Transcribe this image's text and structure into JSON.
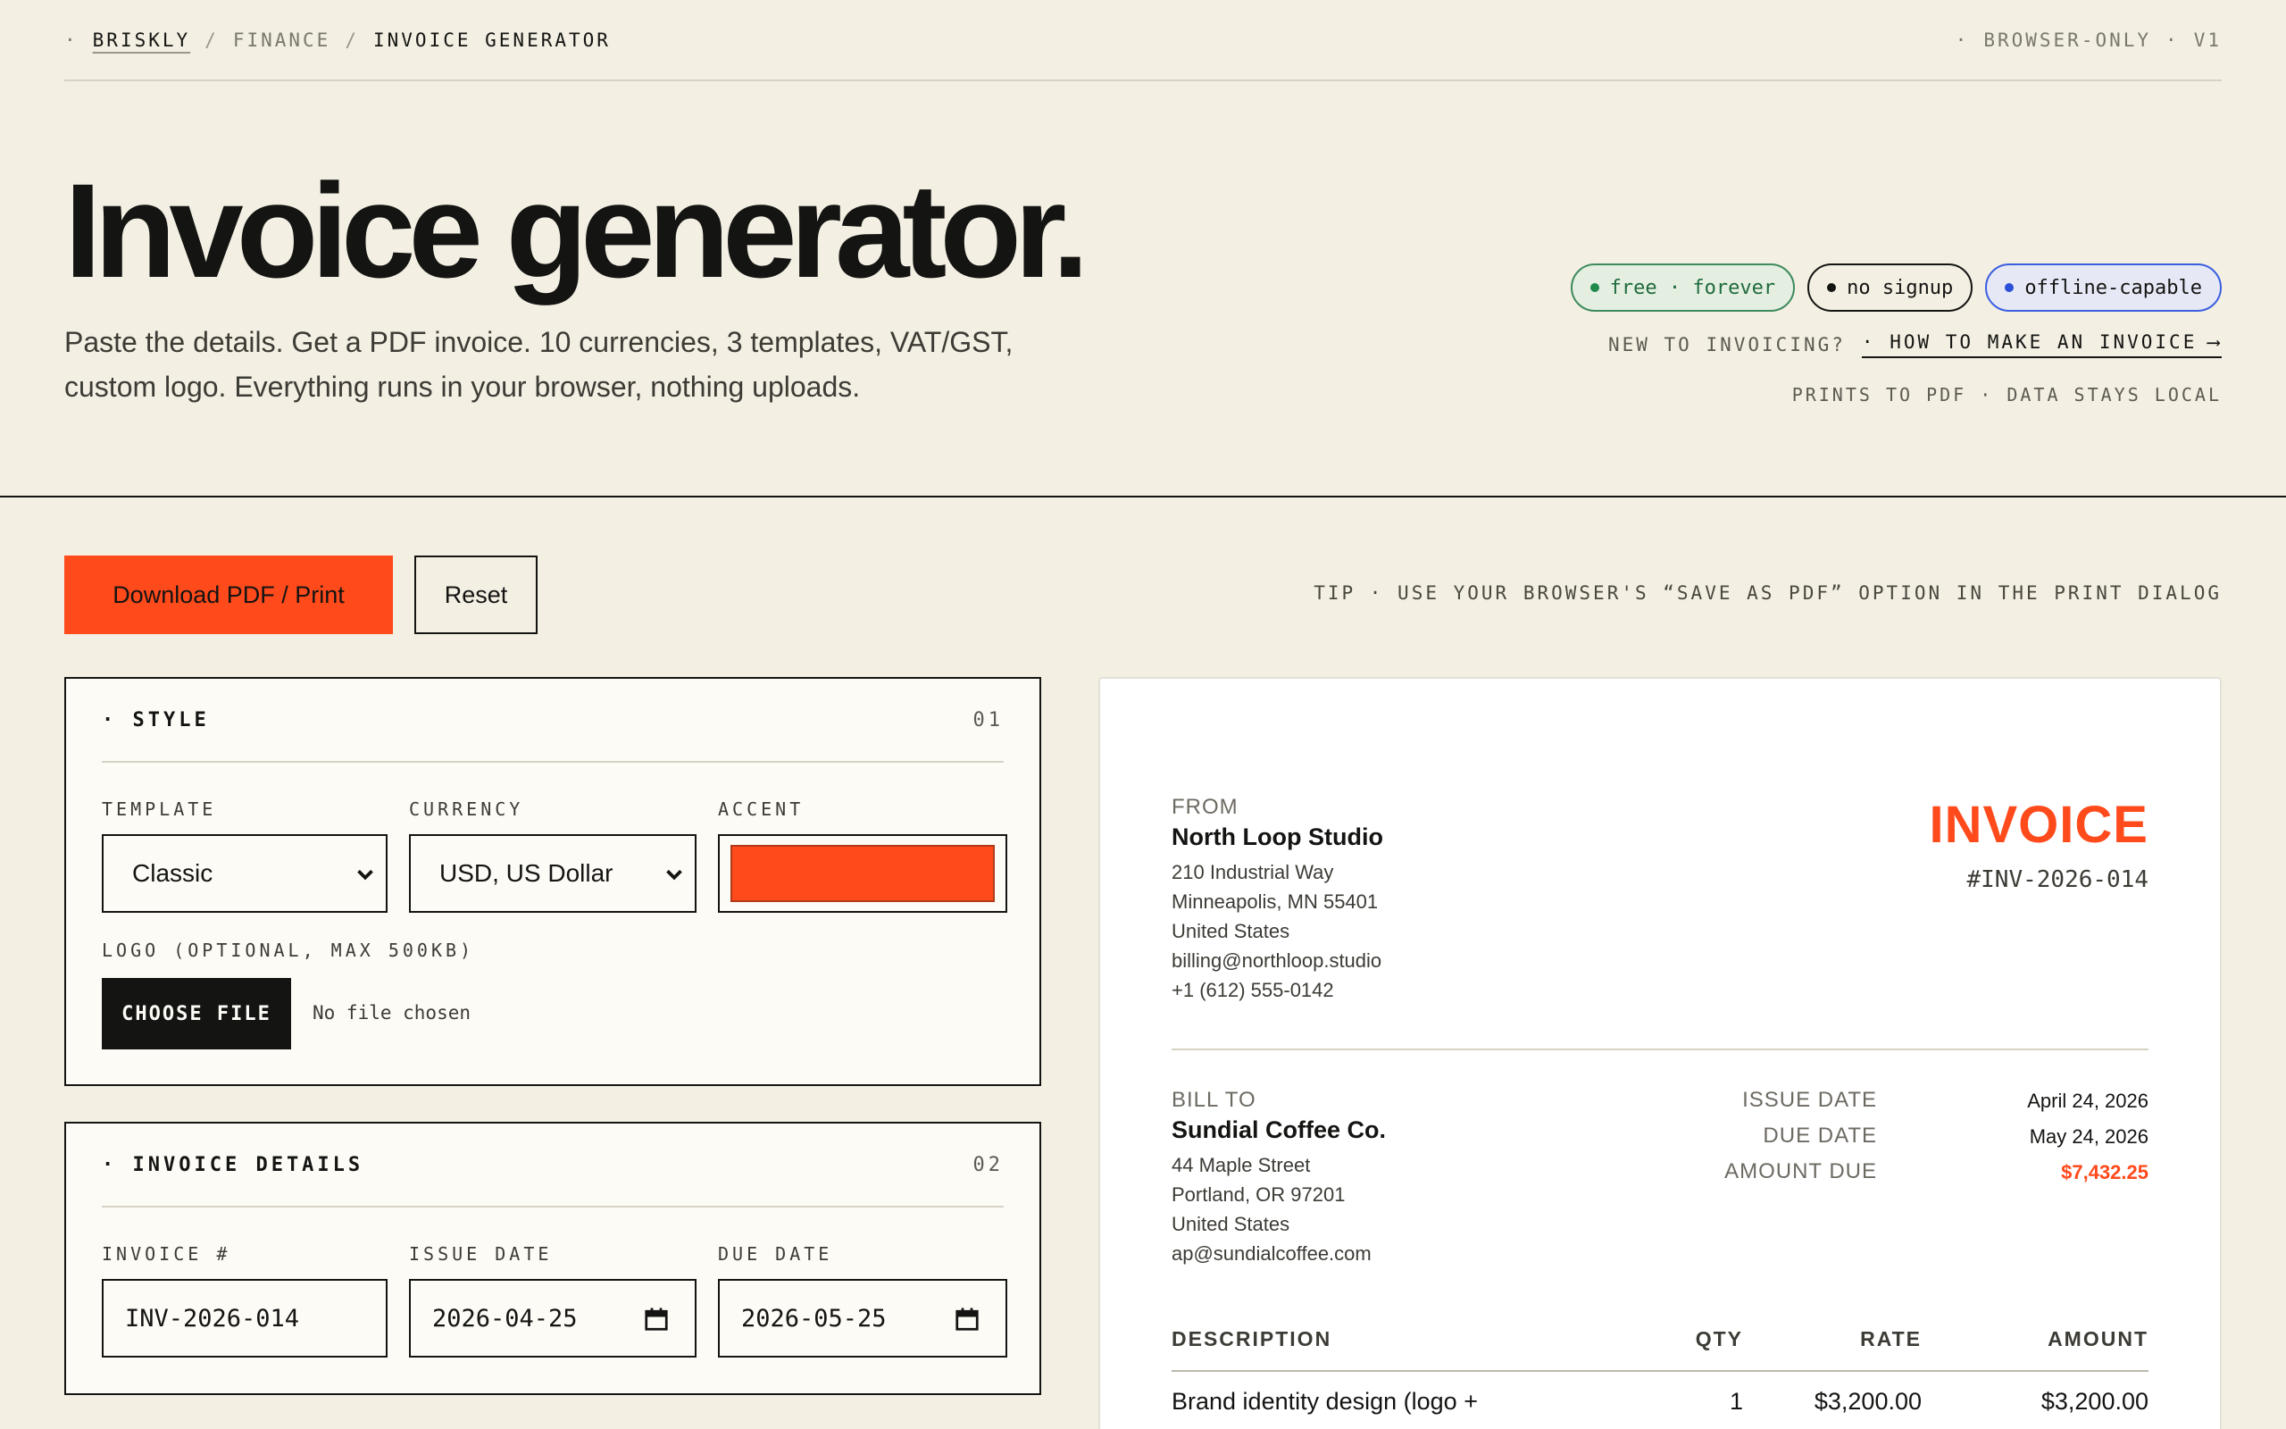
{
  "breadcrumb": {
    "lead": "·",
    "brand": "BRISKLY",
    "sep": "/",
    "section": "FINANCE",
    "current": "INVOICE GENERATOR"
  },
  "topright": {
    "dot": "·",
    "mode": "BROWSER-ONLY",
    "version": "V1"
  },
  "hero": {
    "title": "Invoice generator.",
    "subtitle": "Paste the details. Get a PDF invoice. 10 currencies, 3 templates, VAT/GST, custom logo. Everything runs in your browser, nothing uploads."
  },
  "badges": [
    {
      "label": "free · forever",
      "color": "#1f8a4a"
    },
    {
      "label": "no signup",
      "color": "#141412"
    },
    {
      "label": "offline-capable",
      "color": "#2b4fd8"
    }
  ],
  "howto": {
    "prefix": "NEW TO INVOICING?",
    "link": "· HOW TO MAKE AN INVOICE",
    "arrow": "⟶"
  },
  "printnote": "PRINTS TO PDF · DATA STAYS LOCAL",
  "toolbar": {
    "download_label": "Download PDF / Print",
    "reset_label": "Reset",
    "tip": "TIP · USE YOUR BROWSER'S “SAVE AS PDF” OPTION IN THE PRINT DIALOG"
  },
  "style_panel": {
    "title": "· STYLE",
    "num": "01",
    "template_label": "TEMPLATE",
    "template_value": "Classic",
    "currency_label": "CURRENCY",
    "currency_value": "USD, US Dollar",
    "accent_label": "ACCENT",
    "accent_color": "#ff4a1c",
    "logo_label": "LOGO (OPTIONAL, MAX 500KB)",
    "file_button": "CHOOSE FILE",
    "file_status": "No file chosen"
  },
  "details_panel": {
    "title": "· INVOICE DETAILS",
    "num": "02",
    "invoice_label": "INVOICE #",
    "invoice_value": "INV-2026-014",
    "issue_label": "ISSUE DATE",
    "issue_value": "2026-04-25",
    "due_label": "DUE DATE",
    "due_value": "2026-05-25"
  },
  "invoice": {
    "from_label": "FROM",
    "from_name": "North Loop Studio",
    "from_lines": [
      "210 Industrial Way",
      "Minneapolis, MN 55401",
      "United States",
      "billing@northloop.studio",
      "+1 (612) 555-0142"
    ],
    "title": "INVOICE",
    "number": "#INV-2026-014",
    "bill_label": "BILL TO",
    "bill_name": "Sundial Coffee Co.",
    "bill_lines": [
      "44 Maple Street",
      "Portland, OR 97201",
      "United States",
      "ap@sundialcoffee.com"
    ],
    "meta": {
      "issue_label": "ISSUE DATE",
      "issue_value": "April 24, 2026",
      "due_label": "DUE DATE",
      "due_value": "May 24, 2026",
      "amount_label": "AMOUNT DUE",
      "amount_value": "$7,432.25"
    },
    "table": {
      "headers": [
        "DESCRIPTION",
        "QTY",
        "RATE",
        "AMOUNT"
      ],
      "rows": [
        {
          "description": "Brand identity design (logo +",
          "qty": "1",
          "rate": "$3,200.00",
          "amount": "$3,200.00"
        }
      ]
    }
  }
}
